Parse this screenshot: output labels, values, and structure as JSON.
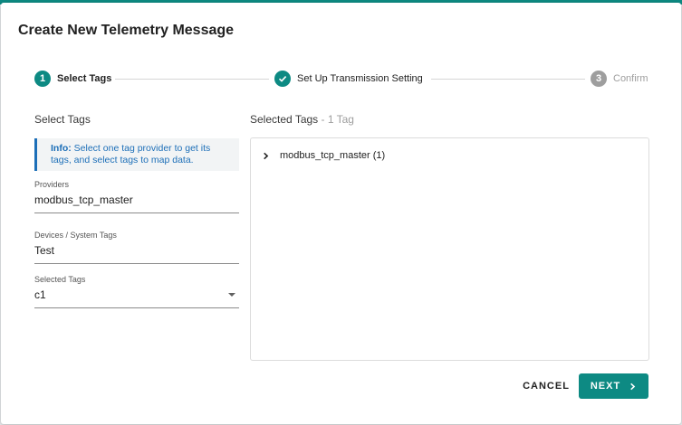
{
  "dialog": {
    "title": "Create New Telemetry Message"
  },
  "stepper": {
    "steps": [
      {
        "number": "1",
        "label": "Select Tags",
        "state": "active"
      },
      {
        "number": "",
        "label": "Set Up Transmission Setting",
        "state": "completed",
        "icon": "check-icon"
      },
      {
        "number": "3",
        "label": "Confirm",
        "state": "pending"
      }
    ]
  },
  "left": {
    "title": "Select Tags",
    "info": {
      "prefix": "Info:",
      "text": "Select one tag provider to get its tags, and select tags to map data."
    },
    "providers": {
      "label": "Providers",
      "value": "modbus_tcp_master"
    },
    "devices": {
      "label": "Devices / System Tags",
      "value": "Test"
    },
    "selected_tags": {
      "label": "Selected Tags",
      "value": "c1"
    }
  },
  "right": {
    "title": "Selected Tags",
    "count": "- 1 Tag",
    "tree": [
      {
        "label": "modbus_tcp_master (1)",
        "icon": "chevron-right-icon"
      }
    ]
  },
  "actions": {
    "cancel_label": "CANCEL",
    "next_label": "NEXT"
  },
  "colors": {
    "primary": "#0d8a83",
    "info": "#1d6fb8",
    "muted": "#9e9e9e"
  }
}
